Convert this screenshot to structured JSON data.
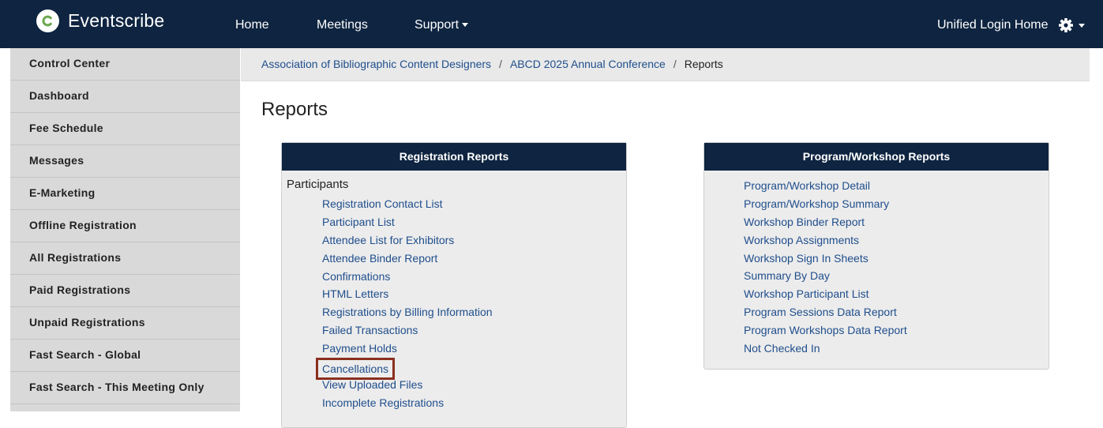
{
  "app": {
    "name": "Eventscribe",
    "logo_letter": "C"
  },
  "topnav": {
    "home": "Home",
    "meetings": "Meetings",
    "support": "Support",
    "unified_login": "Unified Login Home",
    "settings_icon": "gear-icon"
  },
  "sidebar": {
    "items": [
      {
        "label": "Control Center"
      },
      {
        "label": "Dashboard"
      },
      {
        "label": "Fee Schedule"
      },
      {
        "label": "Messages"
      },
      {
        "label": "E-Marketing"
      },
      {
        "label": "Offline Registration"
      },
      {
        "label": "All Registrations"
      },
      {
        "label": "Paid Registrations"
      },
      {
        "label": "Unpaid Registrations"
      },
      {
        "label": "Fast Search - Global"
      },
      {
        "label": "Fast Search - This Meeting Only"
      }
    ]
  },
  "breadcrumb": {
    "org": "Association of Bibliographic Content Designers",
    "event": "ABCD 2025 Annual Conference",
    "current": "Reports",
    "separator": "/"
  },
  "page": {
    "title": "Reports"
  },
  "registration_reports": {
    "header": "Registration Reports",
    "section": "Participants",
    "links": [
      {
        "label": "Registration Contact List"
      },
      {
        "label": "Participant List"
      },
      {
        "label": "Attendee List for Exhibitors"
      },
      {
        "label": "Attendee Binder Report"
      },
      {
        "label": "Confirmations"
      },
      {
        "label": "HTML Letters"
      },
      {
        "label": "Registrations by Billing Information"
      },
      {
        "label": "Failed Transactions"
      },
      {
        "label": "Payment Holds"
      },
      {
        "label": "Cancellations"
      },
      {
        "label": "View Uploaded Files"
      },
      {
        "label": "Incomplete Registrations"
      }
    ]
  },
  "program_reports": {
    "header": "Program/Workshop Reports",
    "links": [
      {
        "label": "Program/Workshop Detail"
      },
      {
        "label": "Program/Workshop Summary"
      },
      {
        "label": "Workshop Binder Report"
      },
      {
        "label": "Workshop Assignments"
      },
      {
        "label": "Workshop Sign In Sheets"
      },
      {
        "label": "Summary By Day"
      },
      {
        "label": "Workshop Participant List"
      },
      {
        "label": "Program Sessions Data Report"
      },
      {
        "label": "Program Workshops Data Report"
      },
      {
        "label": "Not Checked In"
      }
    ]
  },
  "colors": {
    "navbar": "#0e2440",
    "link": "#1f4e8c",
    "highlight_border": "#8b2f1f",
    "sidebar": "#d9d9d9",
    "panel_bg": "#ececec"
  }
}
